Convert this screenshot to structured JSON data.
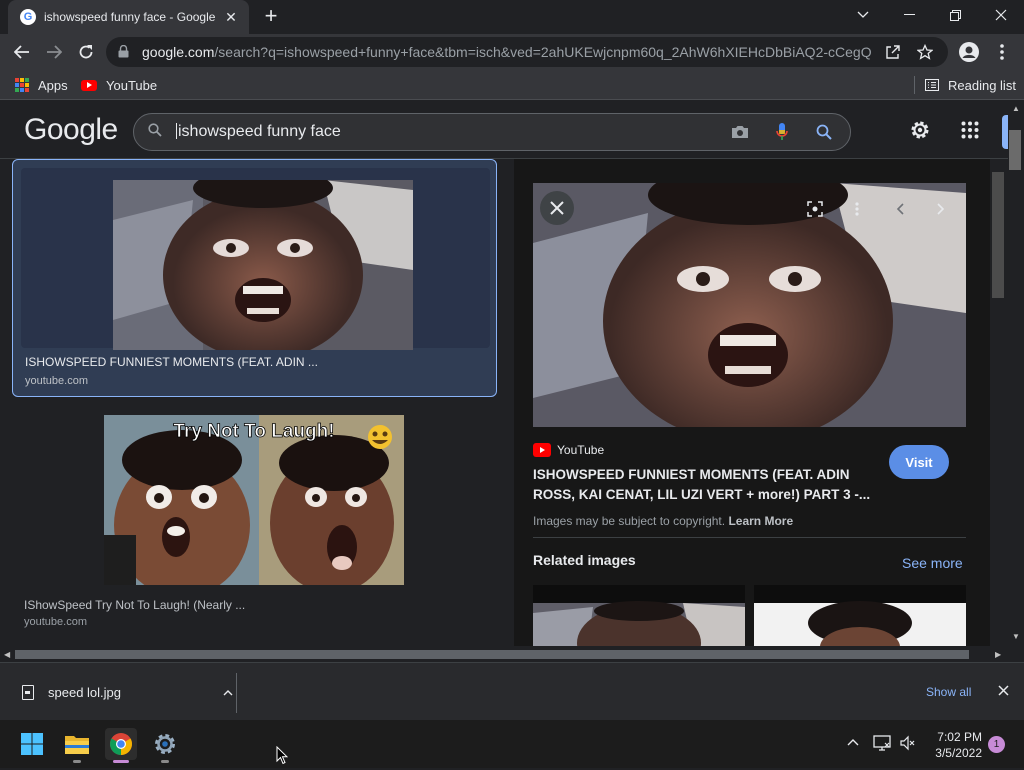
{
  "browser": {
    "tab_title": "ishowspeed funny face - Google Search",
    "url_host": "google.com",
    "url_path": "/search?q=ishowspeed+funny+face&tbm=isch&ved=2ahUKEwjcnpm60q_2AhW6hXIEHcDbBiAQ2-cCegQ..."
  },
  "bookmarks": {
    "apps_label": "Apps",
    "youtube_label": "YouTube",
    "reading_list_label": "Reading list"
  },
  "google": {
    "logo": "Google",
    "query": "ishowspeed funny face"
  },
  "results": [
    {
      "title": "ISHOWSPEED FUNNIEST MOMENTS (FEAT. ADIN ...",
      "source": "youtube.com"
    },
    {
      "title": "IShowSpeed Try Not To Laugh! (Nearly ...",
      "source": "youtube.com",
      "thumb_caption": "Try Not To Laugh!"
    }
  ],
  "preview": {
    "source_name": "YouTube",
    "title": "ISHOWSPEED FUNNIEST MOMENTS (FEAT. ADIN ROSS, KAI CENAT, LIL UZI VERT + more!) PART 3 -...",
    "visit_label": "Visit",
    "copyright_text": "Images may be subject to copyright.",
    "learn_more": "Learn More",
    "related_title": "Related images",
    "see_more": "See more"
  },
  "download": {
    "file_name": "speed lol.jpg",
    "show_all": "Show all"
  },
  "taskbar": {
    "time": "7:02 PM",
    "date": "3/5/2022",
    "notification_count": "1"
  },
  "colors": {
    "accent_blue": "#8ab4f8",
    "selected_card_bg": "#303d54",
    "youtube_red": "#ff0000"
  }
}
